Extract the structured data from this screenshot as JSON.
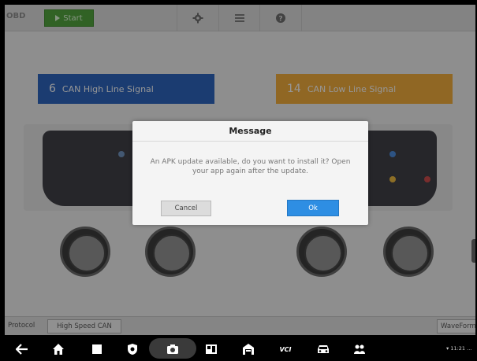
{
  "toolbar": {
    "logo_text": "OBD",
    "start_label": "Start",
    "icons": [
      "gear-icon",
      "list-icon",
      "help-icon"
    ]
  },
  "pins": {
    "high": {
      "number": "6",
      "label": "CAN High Line Signal",
      "color": "#2d62b6"
    },
    "low": {
      "number": "14",
      "label": "CAN Low Line Signal",
      "color": "#e9a63a"
    }
  },
  "statusbar": {
    "protocol_label": "Protocol",
    "protocol_value": "High Speed CAN",
    "waveform_label": "WaveForm"
  },
  "dialog": {
    "title": "Message",
    "message": "An APK update available, do you want to install it? Open your app again after the update.",
    "cancel_label": "Cancel",
    "ok_label": "Ok"
  },
  "navbar": {
    "icons": [
      "back-icon",
      "home-icon",
      "recents-icon",
      "shield-icon",
      "camera-icon",
      "screen-icon",
      "house-icon",
      "vci-icon",
      "car-icon",
      "people-icon"
    ],
    "vci_text": "VCI",
    "system_status": "▾ 11:21 ..."
  },
  "colors": {
    "start_green": "#4f9e3c",
    "ok_blue": "#2e8ee3"
  }
}
